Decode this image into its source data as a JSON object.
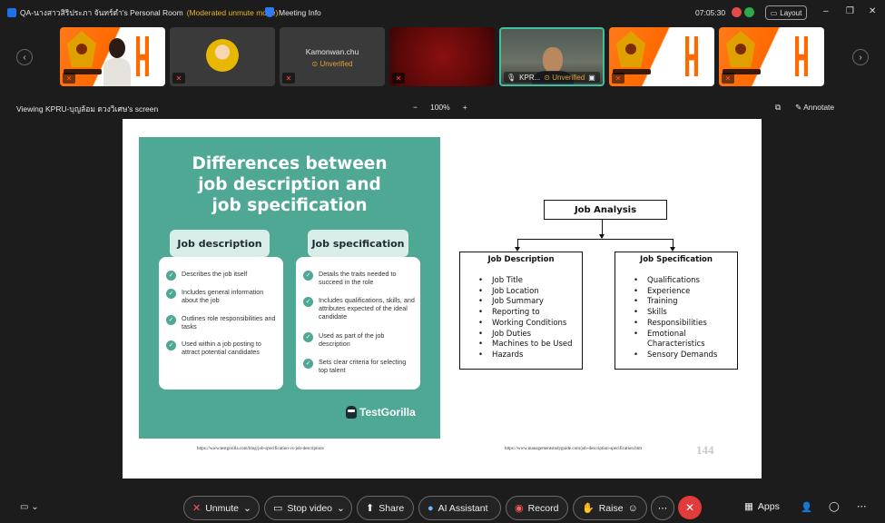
{
  "titlebar": {
    "room": "QA-นางสาวสิริประภา จันทร์ดำ's Personal Room",
    "moderated": "(Moderated unmute mode)",
    "meeting_info": "Meeting Info",
    "clock": "07:05:30",
    "layout": "Layout"
  },
  "filmstrip": {
    "tile3_name": "Kamonwan.chu",
    "unverified": "Unverified",
    "tile6_name": "KPR..."
  },
  "share": {
    "viewing": "Viewing KPRU-บุญล้อม ดวงวิเศษ's screen",
    "zoom": "100%",
    "annotate": "Annotate"
  },
  "slide": {
    "tg_title": [
      "Differences between",
      "job description and",
      "job specification"
    ],
    "left_head": "Job description",
    "right_head": "Job specification",
    "left_items": [
      "Describes the job itself",
      "Includes general information about the job",
      "Outlines role responsibilities and tasks",
      "Used within a job posting to attract potential candidates"
    ],
    "right_items": [
      "Details the traits needed to succeed in the role",
      "Includes qualifications, skills, and attributes expected of the ideal candidate",
      "Used as part of the job description",
      "Sets clear criteria for selecting top talent"
    ],
    "brand": "TestGorilla",
    "ja_title": "Job Analysis",
    "jd_title": "Job Description",
    "jd_items": [
      "Job Title",
      "Job Location",
      "Job Summary",
      "Reporting to",
      "Working Conditions",
      "Job Duties",
      "Machines to be Used",
      "Hazards"
    ],
    "js_title": "Job Specification",
    "js_items": [
      "Qualifications",
      "Experience",
      "Training",
      "Skills",
      "Responsibilities",
      "Emotional Characteristics",
      "Sensory Demands"
    ],
    "src_left": "https://www.testgorilla.com/blog/job-specification-vs-job-description/",
    "src_right": "https://www.managementstudyguide.com/job-description-specification.htm",
    "page": "144"
  },
  "toolbar": {
    "unmute": "Unmute",
    "stop_video": "Stop video",
    "share": "Share",
    "ai": "AI Assistant",
    "record": "Record",
    "raise": "Raise",
    "apps": "Apps"
  },
  "colors": {
    "accent_teal": "#4ea894",
    "end_red": "#e23b3b",
    "warning": "#e6a23c"
  }
}
